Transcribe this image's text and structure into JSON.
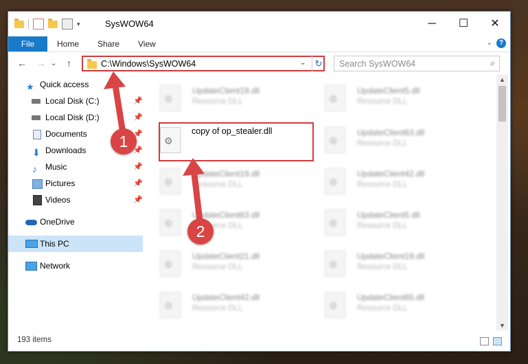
{
  "window": {
    "title": "SysWOW64",
    "controls": {
      "minimize": "─",
      "maximize": "☐",
      "close": "✕"
    }
  },
  "ribbon": {
    "tabs": [
      "File",
      "Home",
      "Share",
      "View"
    ],
    "caret": "⌄",
    "help": "?"
  },
  "nav": {
    "back": "←",
    "forward": "→",
    "recent": "⌄",
    "up": "↑",
    "address": "C:\\Windows\\SysWOW64",
    "dropdown": "⌄",
    "refresh": "↻",
    "search_placeholder": "Search SysWOW64",
    "search_icon": "⌕"
  },
  "sidebar": {
    "items": [
      {
        "label": "Quick access",
        "icon": "star-icon",
        "pinned": false
      },
      {
        "label": "Local Disk (C:)",
        "icon": "drive-icon",
        "pinned": true
      },
      {
        "label": "Local Disk (D:)",
        "icon": "drive-icon",
        "pinned": true
      },
      {
        "label": "Documents",
        "icon": "documents-icon",
        "pinned": true
      },
      {
        "label": "Downloads",
        "icon": "downloads-icon",
        "pinned": true
      },
      {
        "label": "Music",
        "icon": "music-icon",
        "pinned": true
      },
      {
        "label": "Pictures",
        "icon": "pictures-icon",
        "pinned": true
      },
      {
        "label": "Videos",
        "icon": "videos-icon",
        "pinned": true
      },
      {
        "label": "OneDrive",
        "icon": "cloud-icon",
        "pinned": false
      },
      {
        "label": "This PC",
        "icon": "computer-icon",
        "pinned": false,
        "selected": true
      },
      {
        "label": "Network",
        "icon": "network-icon",
        "pinned": false
      }
    ],
    "pin_glyph": "📌"
  },
  "files": {
    "left": [
      {
        "name": "UpdateClient19.dll",
        "type": "Resource DLL"
      },
      {
        "name": "copy of op_stealer.dll",
        "type": ""
      },
      {
        "name": "UpdateClient19.dll",
        "type": "Resource DLL"
      },
      {
        "name": "UpdateClient63.dll",
        "type": "Resource DLL"
      },
      {
        "name": "UpdateClient21.dll",
        "type": "Resource DLL"
      },
      {
        "name": "UpdateClient42.dll",
        "type": "Resource DLL"
      }
    ],
    "right": [
      {
        "name": "UpdateClient5.dll",
        "type": "Resource DLL"
      },
      {
        "name": "UpdateClient63.dll",
        "type": "Resource DLL"
      },
      {
        "name": "UpdateClient42.dll",
        "type": "Resource DLL"
      },
      {
        "name": "UpdateClient5.dll",
        "type": "Resource DLL"
      },
      {
        "name": "UpdateClient19.dll",
        "type": "Resource DLL"
      },
      {
        "name": "UpdateClient65.dll",
        "type": "Resource DLL"
      }
    ],
    "file_icon": "⚙"
  },
  "status": {
    "count": "193 items"
  },
  "annotations": {
    "marker1": "1",
    "marker2": "2",
    "color": "#d94444"
  },
  "colors": {
    "accent": "#1979ca",
    "highlight": "#d23a3a",
    "selection": "#cce4f7"
  }
}
